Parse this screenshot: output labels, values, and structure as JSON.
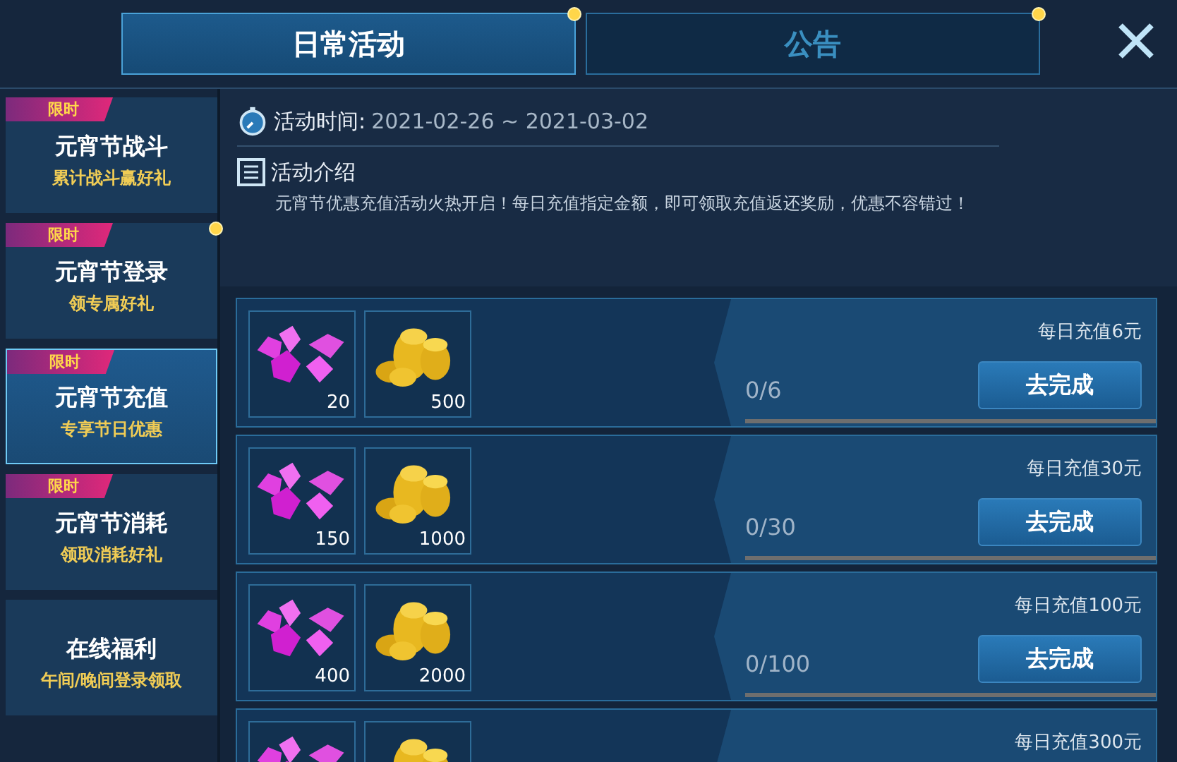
{
  "tabs": [
    {
      "label": "日常活动",
      "selected": true,
      "dot": true
    },
    {
      "label": "公告",
      "selected": false,
      "dot": true
    }
  ],
  "sidebar": {
    "items": [
      {
        "tag": "限时",
        "title": "元宵节战斗",
        "subtitle": "累计战斗赢好礼",
        "selected": false,
        "dot": false
      },
      {
        "tag": "限时",
        "title": "元宵节登录",
        "subtitle": "领专属好礼",
        "selected": false,
        "dot": true
      },
      {
        "tag": "限时",
        "title": "元宵节充值",
        "subtitle": "专享节日优惠",
        "selected": true,
        "dot": false
      },
      {
        "tag": "限时",
        "title": "元宵节消耗",
        "subtitle": "领取消耗好礼",
        "selected": false,
        "dot": false
      },
      {
        "title": "在线福利",
        "subtitle": "午间/晚间登录领取",
        "selected": false,
        "dot": false
      }
    ]
  },
  "activity": {
    "time_label": "活动时间:",
    "time_value": "2021-02-26 ~ 2021-03-02",
    "intro_label": "活动介绍",
    "intro_text": "元宵节优惠充值活动火热开启！每日充值指定金额，即可领取充值返还奖励，优惠不容错过！"
  },
  "tasks": [
    {
      "rewards": [
        {
          "kind": "gem",
          "amount": "20"
        },
        {
          "kind": "coin",
          "amount": "500"
        }
      ],
      "title": "每日充值6元",
      "progress": "0/6",
      "level": 0,
      "button": "去完成"
    },
    {
      "rewards": [
        {
          "kind": "gem",
          "amount": "150"
        },
        {
          "kind": "coin",
          "amount": "1000"
        }
      ],
      "title": "每日充值30元",
      "progress": "0/30",
      "level": 0,
      "button": "去完成"
    },
    {
      "rewards": [
        {
          "kind": "gem",
          "amount": "400"
        },
        {
          "kind": "coin",
          "amount": "2000"
        }
      ],
      "title": "每日充值100元",
      "progress": "0/100",
      "level": 0,
      "button": "去完成"
    },
    {
      "rewards": [
        {
          "kind": "gem"
        },
        {
          "kind": "coin"
        }
      ],
      "title": "每日充值300元"
    }
  ]
}
